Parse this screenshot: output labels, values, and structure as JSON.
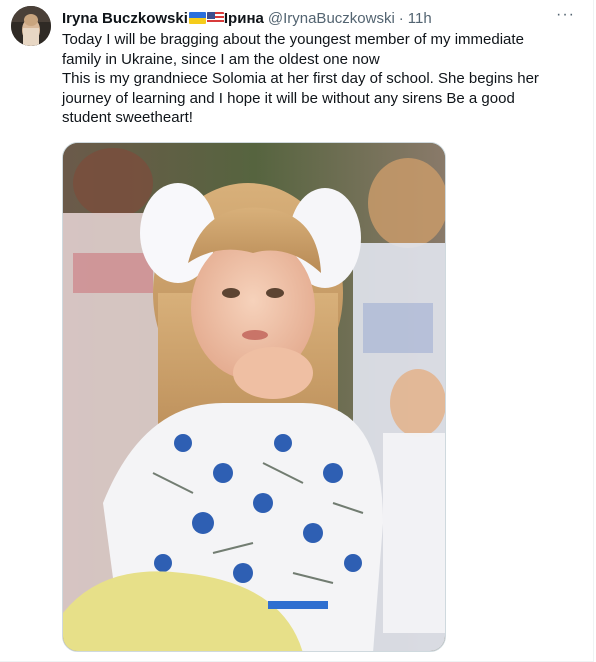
{
  "tweet": {
    "author": {
      "name": "Iryna Buczkowski",
      "name_suffix": "Ірина",
      "handle": "@IrynaBuczkowski",
      "separator": "·",
      "time": "11h",
      "avatar_icon": "user-avatar",
      "flags": [
        "ukraine-flag-icon",
        "usa-flag-icon"
      ]
    },
    "more_label": "···",
    "text_lines": [
      "Today I will be bragging about the youngest member of my immediate",
      "family in Ukraine, since I am the oldest one now",
      "This is my grandniece Solomia at her first day of school. She begins her",
      "journey of learning and I hope it will be without any sirens Be a good",
      "student sweetheart!"
    ],
    "media": {
      "type": "photo",
      "subject": "girl in embroidered vyshyvanka with white hair bows"
    }
  },
  "colors": {
    "text_primary": "#0f1419",
    "text_secondary": "#536471",
    "border": "#cfd9de"
  }
}
